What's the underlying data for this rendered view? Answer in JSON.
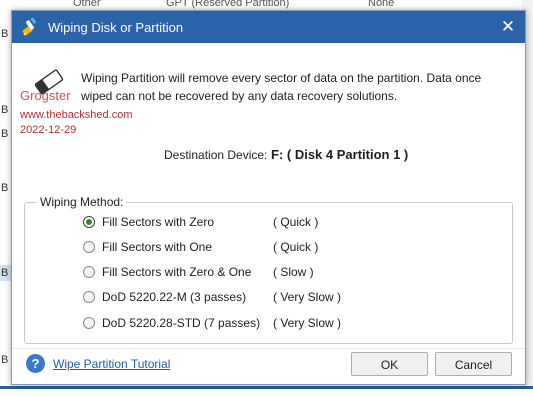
{
  "background": {
    "header_cells": [
      "Other",
      "GPT (Reserved Partition)",
      "None"
    ],
    "row_marker": "B"
  },
  "dialog": {
    "title": "Wiping Disk or Partition",
    "close_label": "✕",
    "warning": "Wiping Partition will remove every sector of data on the partition. Data once wiped can not be recovered by any data recovery solutions.",
    "watermark": {
      "name": "Grogster",
      "url": "www.thebackshed.com",
      "date": "2022-12-29"
    },
    "destination_label": "Destination Device:",
    "destination_value": "F: ( Disk 4 Partition 1 )",
    "method_legend": "Wiping Method:",
    "options": [
      {
        "label": "Fill Sectors with Zero",
        "speed": "( Quick )",
        "selected": true
      },
      {
        "label": "Fill Sectors with One",
        "speed": "( Quick )",
        "selected": false
      },
      {
        "label": "Fill Sectors with Zero & One",
        "speed": "( Slow )",
        "selected": false
      },
      {
        "label": "DoD 5220.22-M (3 passes)",
        "speed": "( Very Slow )",
        "selected": false
      },
      {
        "label": "DoD 5220.28-STD (7 passes)",
        "speed": "( Very Slow )",
        "selected": false
      }
    ],
    "help_icon": "?",
    "tutorial_link": "Wipe Partition Tutorial",
    "ok_label": "OK",
    "cancel_label": "Cancel"
  },
  "colors": {
    "titlebar": "#2c62a8",
    "link": "#1a5fb4",
    "watermark": "#b03030",
    "radio_selected": "#2a8a2a"
  },
  "icons": {
    "title": "wipe-brush-icon",
    "eraser": "eraser-icon",
    "help": "help-icon",
    "close": "close-icon"
  }
}
